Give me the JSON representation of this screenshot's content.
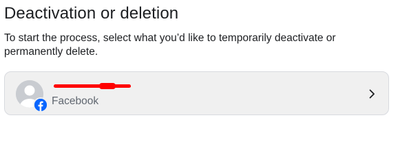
{
  "page": {
    "title": "Deactivation or deletion",
    "subtitle": "To start the process, select what you’d like to temporarily deactivate or permanently delete."
  },
  "account": {
    "name": "",
    "platform": "Facebook"
  },
  "colors": {
    "card_background": "#f0f0f0",
    "card_border": "#d8dadf",
    "facebook_blue": "#0866ff",
    "redaction": "#ff0000",
    "secondary_text": "#606770"
  },
  "icons": {
    "avatar": "default-profile-avatar-icon",
    "badge": "facebook-logo-icon",
    "chevron": "chevron-right-icon"
  }
}
